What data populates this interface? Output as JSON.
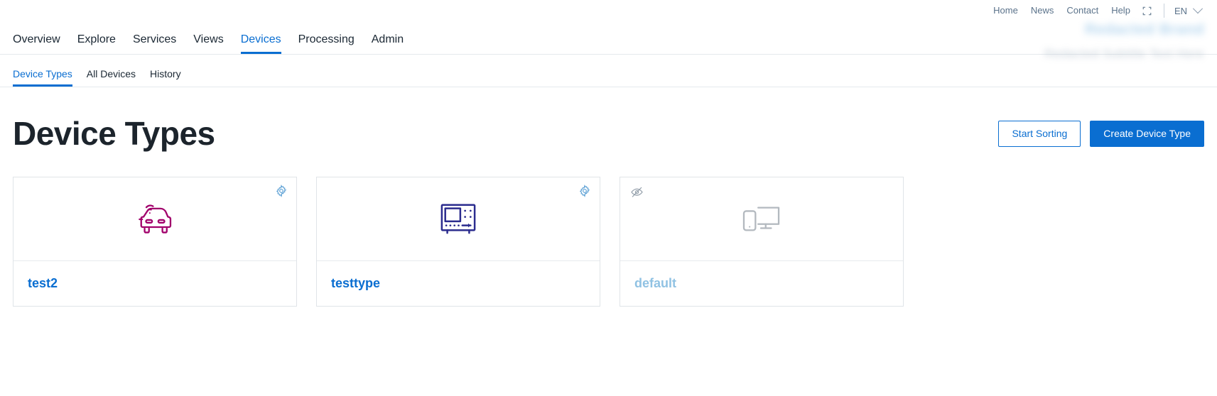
{
  "utility": {
    "links": [
      {
        "label": "Home",
        "name": "home"
      },
      {
        "label": "News",
        "name": "news"
      },
      {
        "label": "Contact",
        "name": "contact"
      },
      {
        "label": "Help",
        "name": "help"
      }
    ],
    "fullscreen_icon": "fullscreen-icon",
    "language": "EN",
    "language_chevron": "chevron-down-icon"
  },
  "brand": {
    "line1": "Redacted Brand",
    "line2": "Redacted Subtitle Text Here"
  },
  "main_nav": {
    "items": [
      {
        "label": "Overview",
        "active": false
      },
      {
        "label": "Explore",
        "active": false
      },
      {
        "label": "Services",
        "active": false
      },
      {
        "label": "Views",
        "active": false
      },
      {
        "label": "Devices",
        "active": true
      },
      {
        "label": "Processing",
        "active": false
      },
      {
        "label": "Admin",
        "active": false
      }
    ]
  },
  "sub_nav": {
    "items": [
      {
        "label": "Device Types",
        "active": true
      },
      {
        "label": "All Devices",
        "active": false
      },
      {
        "label": "History",
        "active": false
      }
    ]
  },
  "page": {
    "title": "Device Types",
    "start_sorting_label": "Start Sorting",
    "create_label": "Create Device Type"
  },
  "colors": {
    "accent_blue": "#0a6ed1",
    "title_dark": "#1c242c",
    "card_border": "#e0e4e8",
    "disabled_blue": "#90c2e3",
    "car_icon": "#a1006b",
    "scope_icon": "#2b2c8e",
    "grey_icon": "#b3b9bf"
  },
  "cards": [
    {
      "name": "test2",
      "icon": "connected-car-icon",
      "gear_icon": "gear-icon",
      "hidden": false,
      "disabled": false
    },
    {
      "name": "testtype",
      "icon": "oscilloscope-icon",
      "gear_icon": "gear-icon",
      "hidden": false,
      "disabled": false
    },
    {
      "name": "default",
      "icon": "monitor-phone-icon",
      "gear_icon": "gear-icon",
      "hidden_icon": "eye-slash-icon",
      "hidden": true,
      "disabled": true
    }
  ]
}
